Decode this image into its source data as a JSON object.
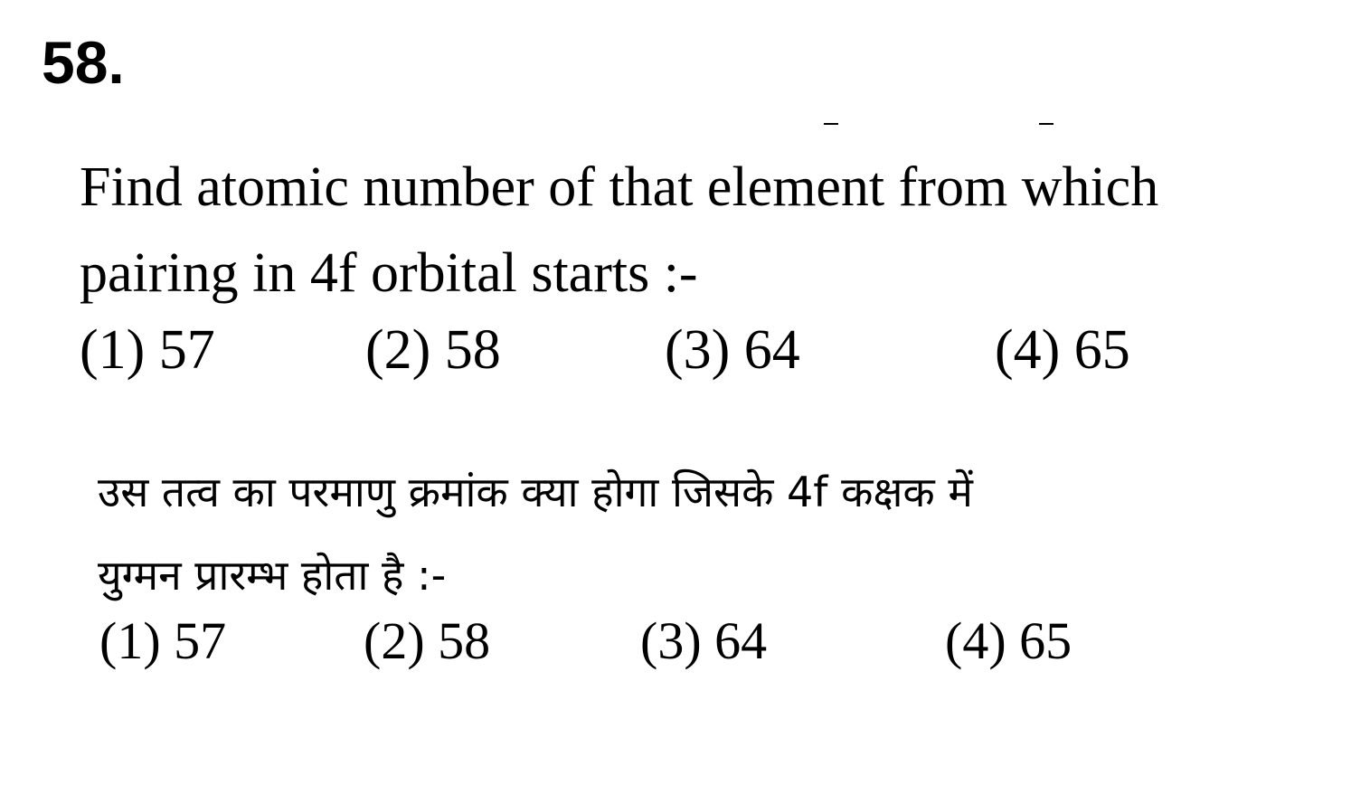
{
  "question_number": "58.",
  "english": {
    "question_line1": "Find atomic number of that element from which",
    "question_line2": "pairing in 4f orbital starts :-",
    "options": [
      "(1) 57",
      "(2) 58",
      "(3) 64",
      "(4) 65"
    ]
  },
  "hindi": {
    "question_line1": "उस तत्व का परमाणु क्रमांक क्या होगा जिसके 4f कक्षक में",
    "question_line2": "युग्मन प्रारम्भ होता है :-",
    "options": [
      "(1) 57",
      "(2) 58",
      "(3) 64",
      "(4) 65"
    ]
  }
}
